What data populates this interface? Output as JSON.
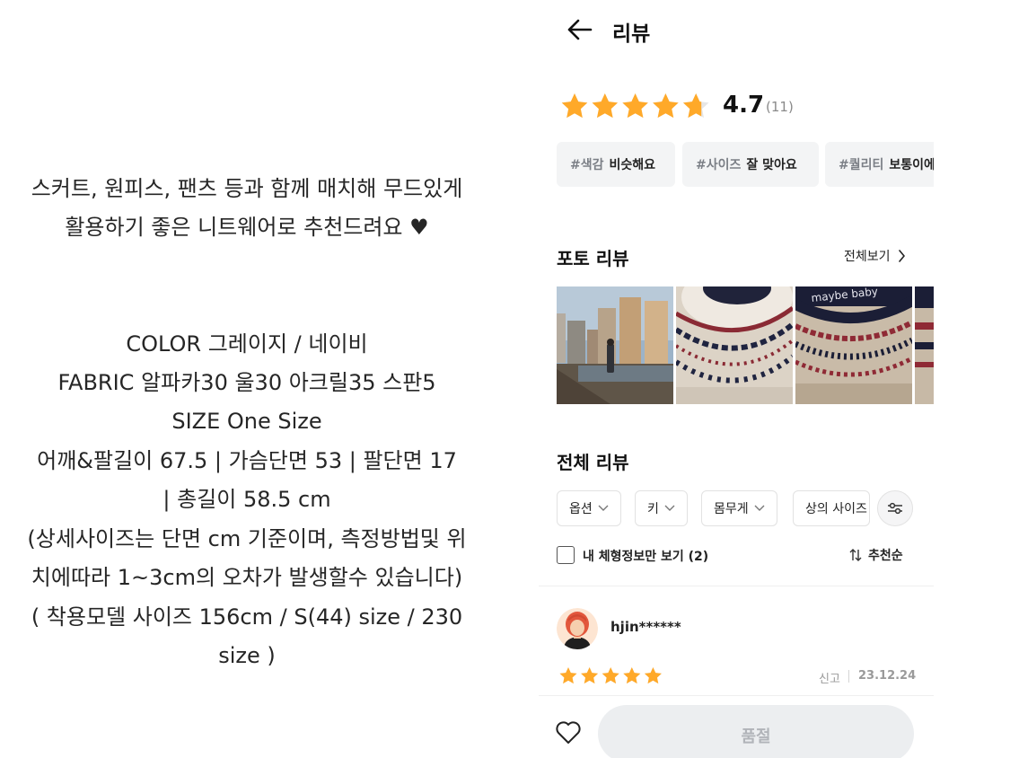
{
  "description": {
    "lines": [
      "스커트, 원피스, 팬츠 등과 함께 매치해 무드있게",
      "활용하기 좋은 니트웨어로 추천드려요 ♥",
      "COLOR 그레이지 / 네이비",
      "FABRIC 알파카30 울30 아크릴35 스판5",
      "SIZE One Size",
      "어깨&팔길이 67.5  |  가슴단면 53  |  팔단면 17",
      "|  총길이 58.5 cm",
      "(상세사이즈는 단면 cm 기준이며, 측정방법및 위",
      "치에따라 1~3cm의 오차가 발생할수 있습니다)",
      "( 착용모델 사이즈 156cm / S(44) size / 230",
      "size )"
    ]
  },
  "header": {
    "title": "리뷰",
    "back_icon": "arrow-left-icon"
  },
  "summary": {
    "rating": "4.7",
    "count": "(11)",
    "stars_value": 4.7,
    "star_color": "#ffa929"
  },
  "tags": [
    {
      "key": "#색감",
      "value": "비슷해요"
    },
    {
      "key": "#사이즈",
      "value": "잘 맞아요"
    },
    {
      "key": "#퀄리티",
      "value": "보통이에요"
    }
  ],
  "photo_reviews": {
    "title": "포토 리뷰",
    "see_all": "전체보기",
    "photo_overlay_text": "maybe baby"
  },
  "all_reviews": {
    "title": "전체 리뷰",
    "filters": [
      "옵션",
      "키",
      "몸무게",
      "상의 사이즈"
    ],
    "my_body_only_label": "내 체형정보만 보기 (2)",
    "sort_label": "추천순"
  },
  "review": {
    "username": "hjin******",
    "stars_value": 5,
    "report_label": "신고",
    "date": "23.12.24"
  },
  "bottom_bar": {
    "button_label": "품절",
    "heart_icon": "heart-outline-icon"
  }
}
